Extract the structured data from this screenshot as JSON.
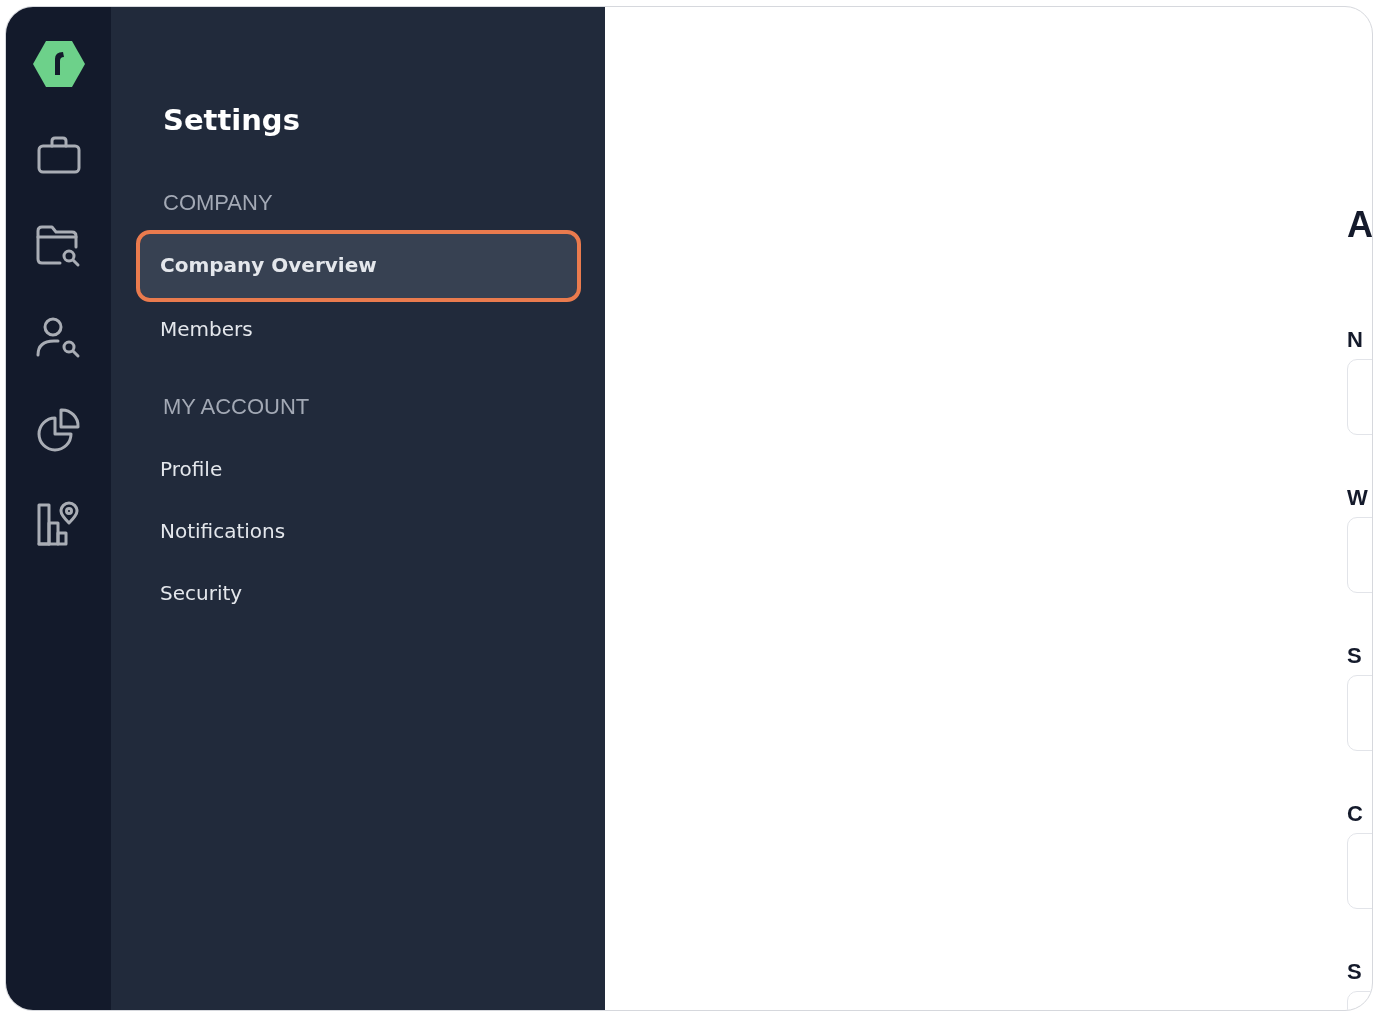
{
  "settings": {
    "title": "Settings",
    "sections": [
      {
        "heading": "COMPANY",
        "items": [
          {
            "label": "Company Overview",
            "selected": true
          },
          {
            "label": "Members",
            "selected": false
          }
        ]
      },
      {
        "heading": "MY ACCOUNT",
        "items": [
          {
            "label": "Profile",
            "selected": false
          },
          {
            "label": "Notifications",
            "selected": false
          },
          {
            "label": "Security",
            "selected": false
          }
        ]
      }
    ]
  },
  "main": {
    "heading": "A",
    "fields": [
      {
        "label": "N"
      },
      {
        "label": "W"
      },
      {
        "label": "S"
      },
      {
        "label": "C"
      },
      {
        "label": "S"
      }
    ]
  }
}
